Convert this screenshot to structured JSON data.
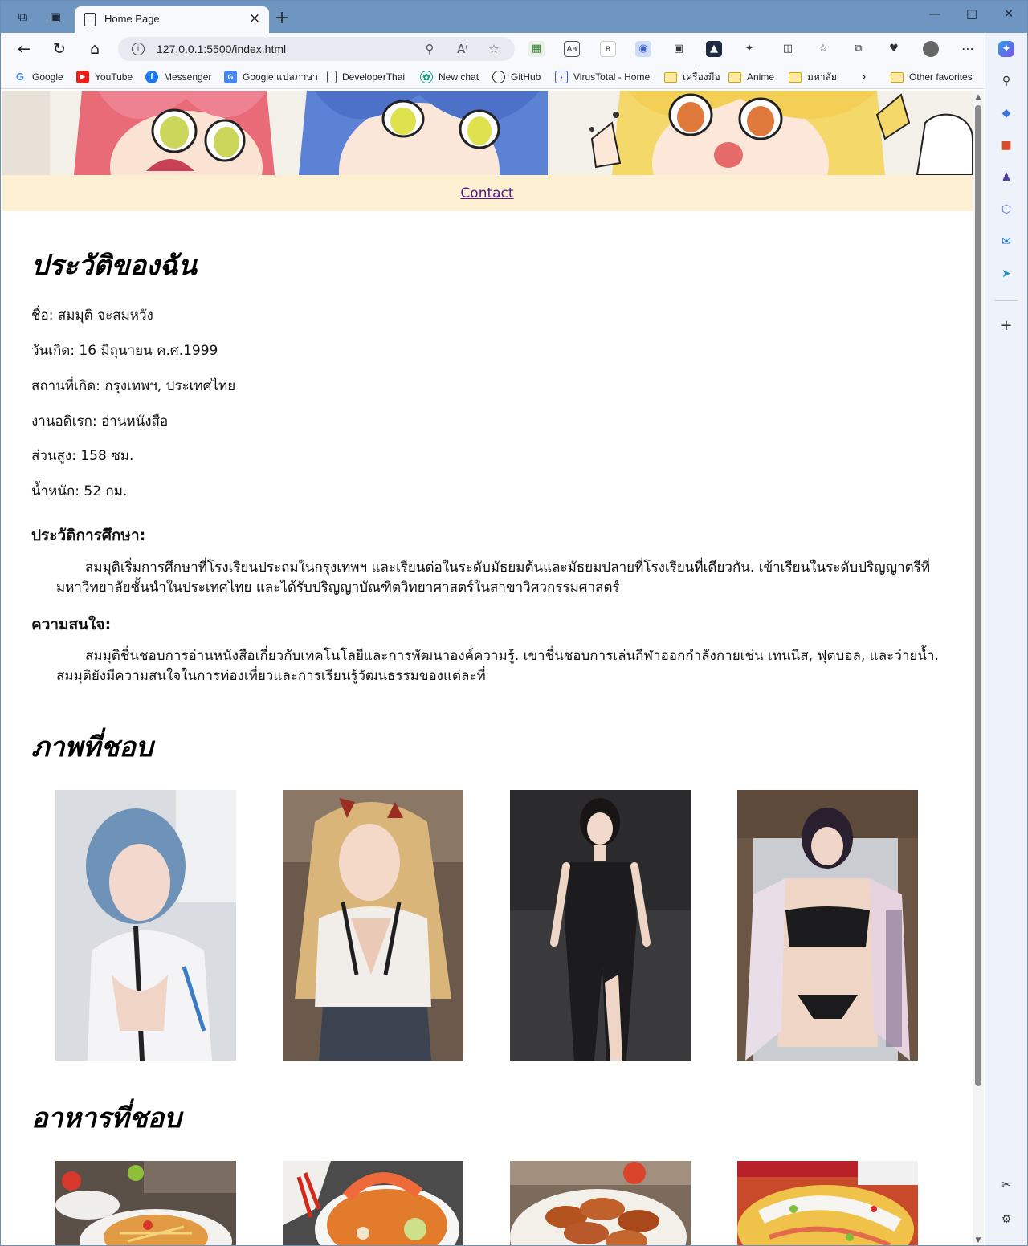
{
  "browser": {
    "tab_title": "Home Page",
    "url": "127.0.0.1:5500/index.html",
    "bookmarks": [
      {
        "label": "Google",
        "icon": "google-icon"
      },
      {
        "label": "YouTube",
        "icon": "youtube-icon"
      },
      {
        "label": "Messenger",
        "icon": "facebook-icon"
      },
      {
        "label": "Google แปลภาษา",
        "icon": "google-translate-icon"
      },
      {
        "label": "DeveloperThai",
        "icon": "page-icon"
      },
      {
        "label": "New chat",
        "icon": "chatgpt-icon"
      },
      {
        "label": "GitHub",
        "icon": "github-icon"
      },
      {
        "label": "VirusTotal - Home",
        "icon": "virustotal-icon"
      },
      {
        "label": "เครื่องมือ",
        "icon": "folder-icon"
      },
      {
        "label": "Anime",
        "icon": "folder-icon"
      },
      {
        "label": "มหาลัย",
        "icon": "folder-icon"
      }
    ],
    "other_favorites": "Other favorites"
  },
  "page": {
    "nav_link": "Contact",
    "bio_heading": "ประวัติของฉัน",
    "info": {
      "name": "ชื่อ: สมมุติ จะสมหวัง",
      "birthday": "วันเกิด: 16 มิถุนายน ค.ศ.1999",
      "birthplace": "สถานที่เกิด: กรุงเทพฯ, ประเทศไทย",
      "hobby": "งานอดิเรก: อ่านหนังสือ",
      "height": "ส่วนสูง: 158 ซม.",
      "weight": "น้ำหนัก: 52 กม."
    },
    "education_heading": "ประวัติการศึกษา:",
    "education_text": "สมมุติเริ่มการศึกษาที่โรงเรียนประถมในกรุงเทพฯ และเรียนต่อในระดับมัธยมต้นและมัธยมปลายที่โรงเรียนที่เดียวกัน. เข้าเรียนในระดับปริญญาตรีที่มหาวิทยาลัยชั้นนำในประเทศไทย และได้รับปริญญาบัณฑิตวิทยาศาสตร์ในสาขาวิศวกรรมศาสตร์",
    "interests_heading": "ความสนใจ:",
    "interests_text": "สมมุติชื่นชอบการอ่านหนังสือเกี่ยวกับเทคโนโลยีและการพัฒนาองค์ความรู้. เขาชื่นชอบการเล่นกีฬาออกกำลังกายเช่น เทนนิส, ฟุตบอล, และว่ายน้ำ. สมมุติยังมีความสนใจในการท่องเที่ยวและการเรียนรู้วัฒนธรรมของแต่ละที่",
    "favorite_images_heading": "ภาพที่ชอบ",
    "favorite_food_heading": "อาหารที่ชอบ"
  },
  "colors": {
    "titlebar": "#6f96c0",
    "navbar_bg": "#fcefd2",
    "link": "#551a8b"
  }
}
